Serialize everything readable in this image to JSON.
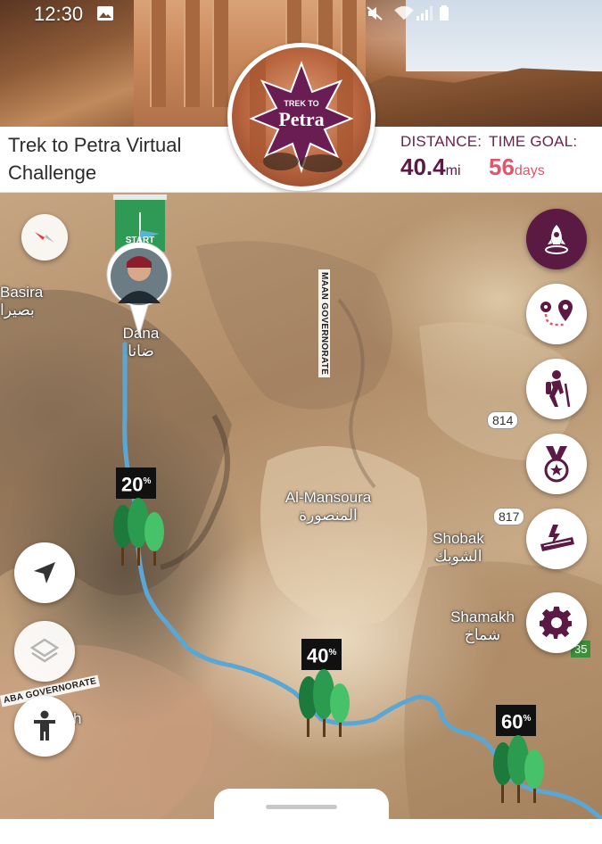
{
  "status_bar": {
    "time": "12:30",
    "icons": [
      "gallery-icon",
      "mute-icon",
      "wifi-icon",
      "signal-icon",
      "battery-icon"
    ]
  },
  "header": {
    "title": "Trek to Petra Virtual Challenge",
    "distance": {
      "label": "DISTANCE:",
      "value": "40.4",
      "unit": "mi"
    },
    "time_goal": {
      "label": "TIME GOAL:",
      "value": "56",
      "unit": "days"
    },
    "badge": {
      "line1": "TREK TO",
      "line2": "Petra"
    },
    "colors": {
      "brand": "#5b1a43",
      "accent": "#e0576b"
    }
  },
  "map": {
    "start_flag": "START",
    "labels": [
      {
        "name": "Basira",
        "arabic": "بصيرا"
      },
      {
        "name": "Dana",
        "arabic": "ضانا"
      },
      {
        "name": "Al-Mansoura",
        "arabic": "المنصورة"
      },
      {
        "name": "Shobak",
        "arabic": "الشوبك"
      },
      {
        "name": "Shamakh",
        "arabic": "شماخ"
      },
      {
        "name": "h",
        "arabic": ""
      }
    ],
    "governorates": [
      "MAAN GOVERNORATE",
      "ABA GOVERNORATE"
    ],
    "roads": [
      "814",
      "817",
      "35"
    ],
    "milestones": [
      {
        "percent": "20",
        "suffix": "%"
      },
      {
        "percent": "40",
        "suffix": "%"
      },
      {
        "percent": "60",
        "suffix": "%"
      }
    ],
    "route_color": "#5aa7d6"
  },
  "controls": {
    "right": [
      "rocket-launch-icon",
      "route-icon",
      "hiker-icon",
      "medal-icon",
      "treadmill-icon",
      "settings-icon"
    ],
    "left": [
      "compass-icon",
      "locate-icon",
      "layers-icon",
      "person-icon"
    ]
  }
}
